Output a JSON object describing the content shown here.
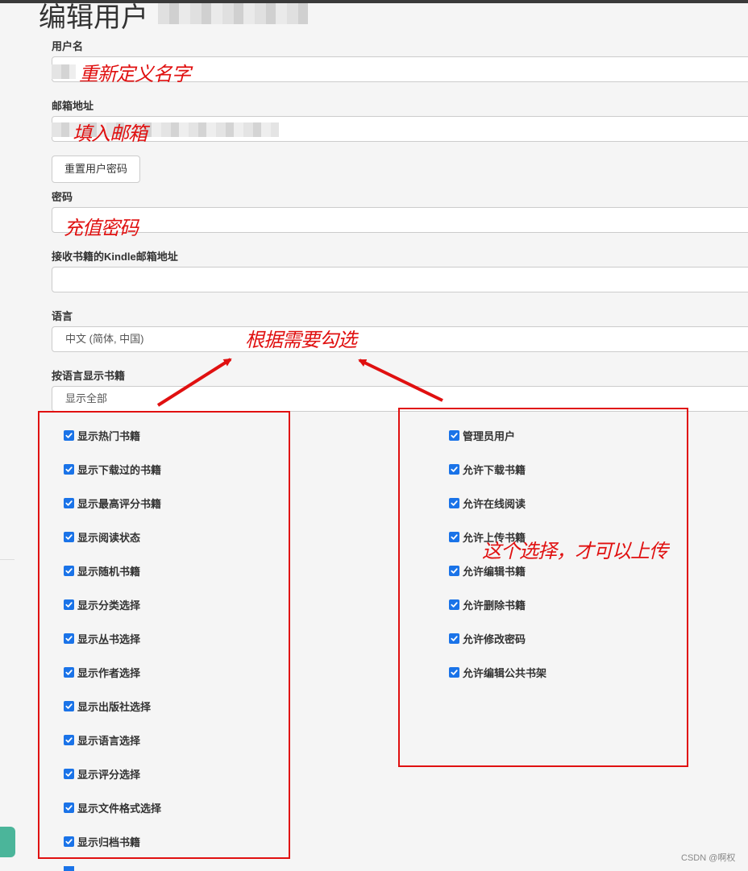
{
  "page": {
    "title": "编辑用户"
  },
  "form": {
    "username": {
      "label": "用户名",
      "value": ""
    },
    "email": {
      "label": "邮箱地址",
      "value": ""
    },
    "reset_password_button": "重置用户密码",
    "password": {
      "label": "密码",
      "value": ""
    },
    "kindle_email": {
      "label": "接收书籍的Kindle邮箱地址",
      "value": ""
    },
    "language": {
      "label": "语言",
      "value": "中文 (简体, 中国)"
    },
    "book_language": {
      "label": "按语言显示书籍",
      "value": "显示全部"
    }
  },
  "left_checkboxes": [
    {
      "label": "显示热门书籍",
      "checked": true
    },
    {
      "label": "显示下载过的书籍",
      "checked": true
    },
    {
      "label": "显示最高评分书籍",
      "checked": true
    },
    {
      "label": "显示阅读状态",
      "checked": true
    },
    {
      "label": "显示随机书籍",
      "checked": true
    },
    {
      "label": "显示分类选择",
      "checked": true
    },
    {
      "label": "显示丛书选择",
      "checked": true
    },
    {
      "label": "显示作者选择",
      "checked": true
    },
    {
      "label": "显示出版社选择",
      "checked": true
    },
    {
      "label": "显示语言选择",
      "checked": true
    },
    {
      "label": "显示评分选择",
      "checked": true
    },
    {
      "label": "显示文件格式选择",
      "checked": true
    },
    {
      "label": "显示归档书籍",
      "checked": true
    }
  ],
  "right_checkboxes": [
    {
      "label": "管理员用户",
      "checked": true
    },
    {
      "label": "允许下载书籍",
      "checked": true
    },
    {
      "label": "允许在线阅读",
      "checked": true
    },
    {
      "label": "允许上传书籍",
      "checked": true
    },
    {
      "label": "允许编辑书籍",
      "checked": true
    },
    {
      "label": "允许删除书籍",
      "checked": true
    },
    {
      "label": "允许修改密码",
      "checked": true
    },
    {
      "label": "允许编辑公共书架",
      "checked": true
    }
  ],
  "annotations": {
    "username": "重新定义名字",
    "email": "填入邮箱",
    "password": "充值密码",
    "select_hint": "根据需要勾选",
    "upload_hint": "这个选择，才可以上传"
  },
  "watermark": "CSDN @啊权",
  "colors": {
    "annotation": "#e01010",
    "checkbox": "#1a73e8",
    "side_tab": "#4bb59a"
  },
  "icons": {
    "checkbox": "checkmark-icon"
  }
}
